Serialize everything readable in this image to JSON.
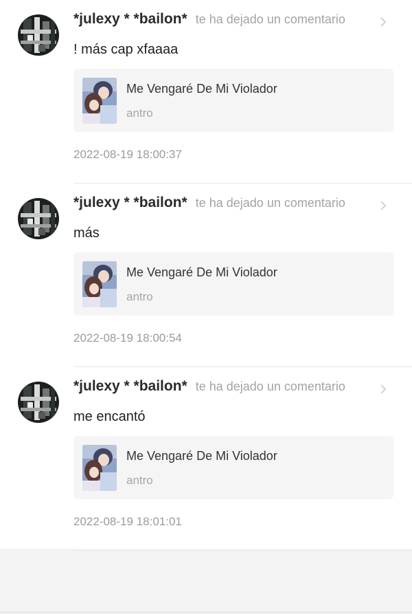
{
  "notifications": [
    {
      "username": "*julexy * *bailon*",
      "action": "te ha dejado un comentario",
      "comment": "! más cap xfaaaa",
      "book_title": "Me Vengaré De Mi Violador",
      "book_subtitle": "antro",
      "timestamp": "2022-08-19 18:00:37"
    },
    {
      "username": "*julexy * *bailon*",
      "action": "te ha dejado un comentario",
      "comment": "más",
      "book_title": "Me Vengaré De Mi Violador",
      "book_subtitle": "antro",
      "timestamp": "2022-08-19 18:00:54"
    },
    {
      "username": "*julexy * *bailon*",
      "action": "te ha dejado un comentario",
      "comment": "me encantó",
      "book_title": "Me Vengaré De Mi Violador",
      "book_subtitle": "antro",
      "timestamp": "2022-08-19 18:01:01"
    }
  ],
  "icons": {
    "avatar": "avatar",
    "chevron": "chevron-right-icon",
    "cover": "book-cover"
  },
  "colors": {
    "background": "#f4f4f5",
    "card": "#f5f5f6",
    "secondary_text": "#a3a3a3"
  }
}
